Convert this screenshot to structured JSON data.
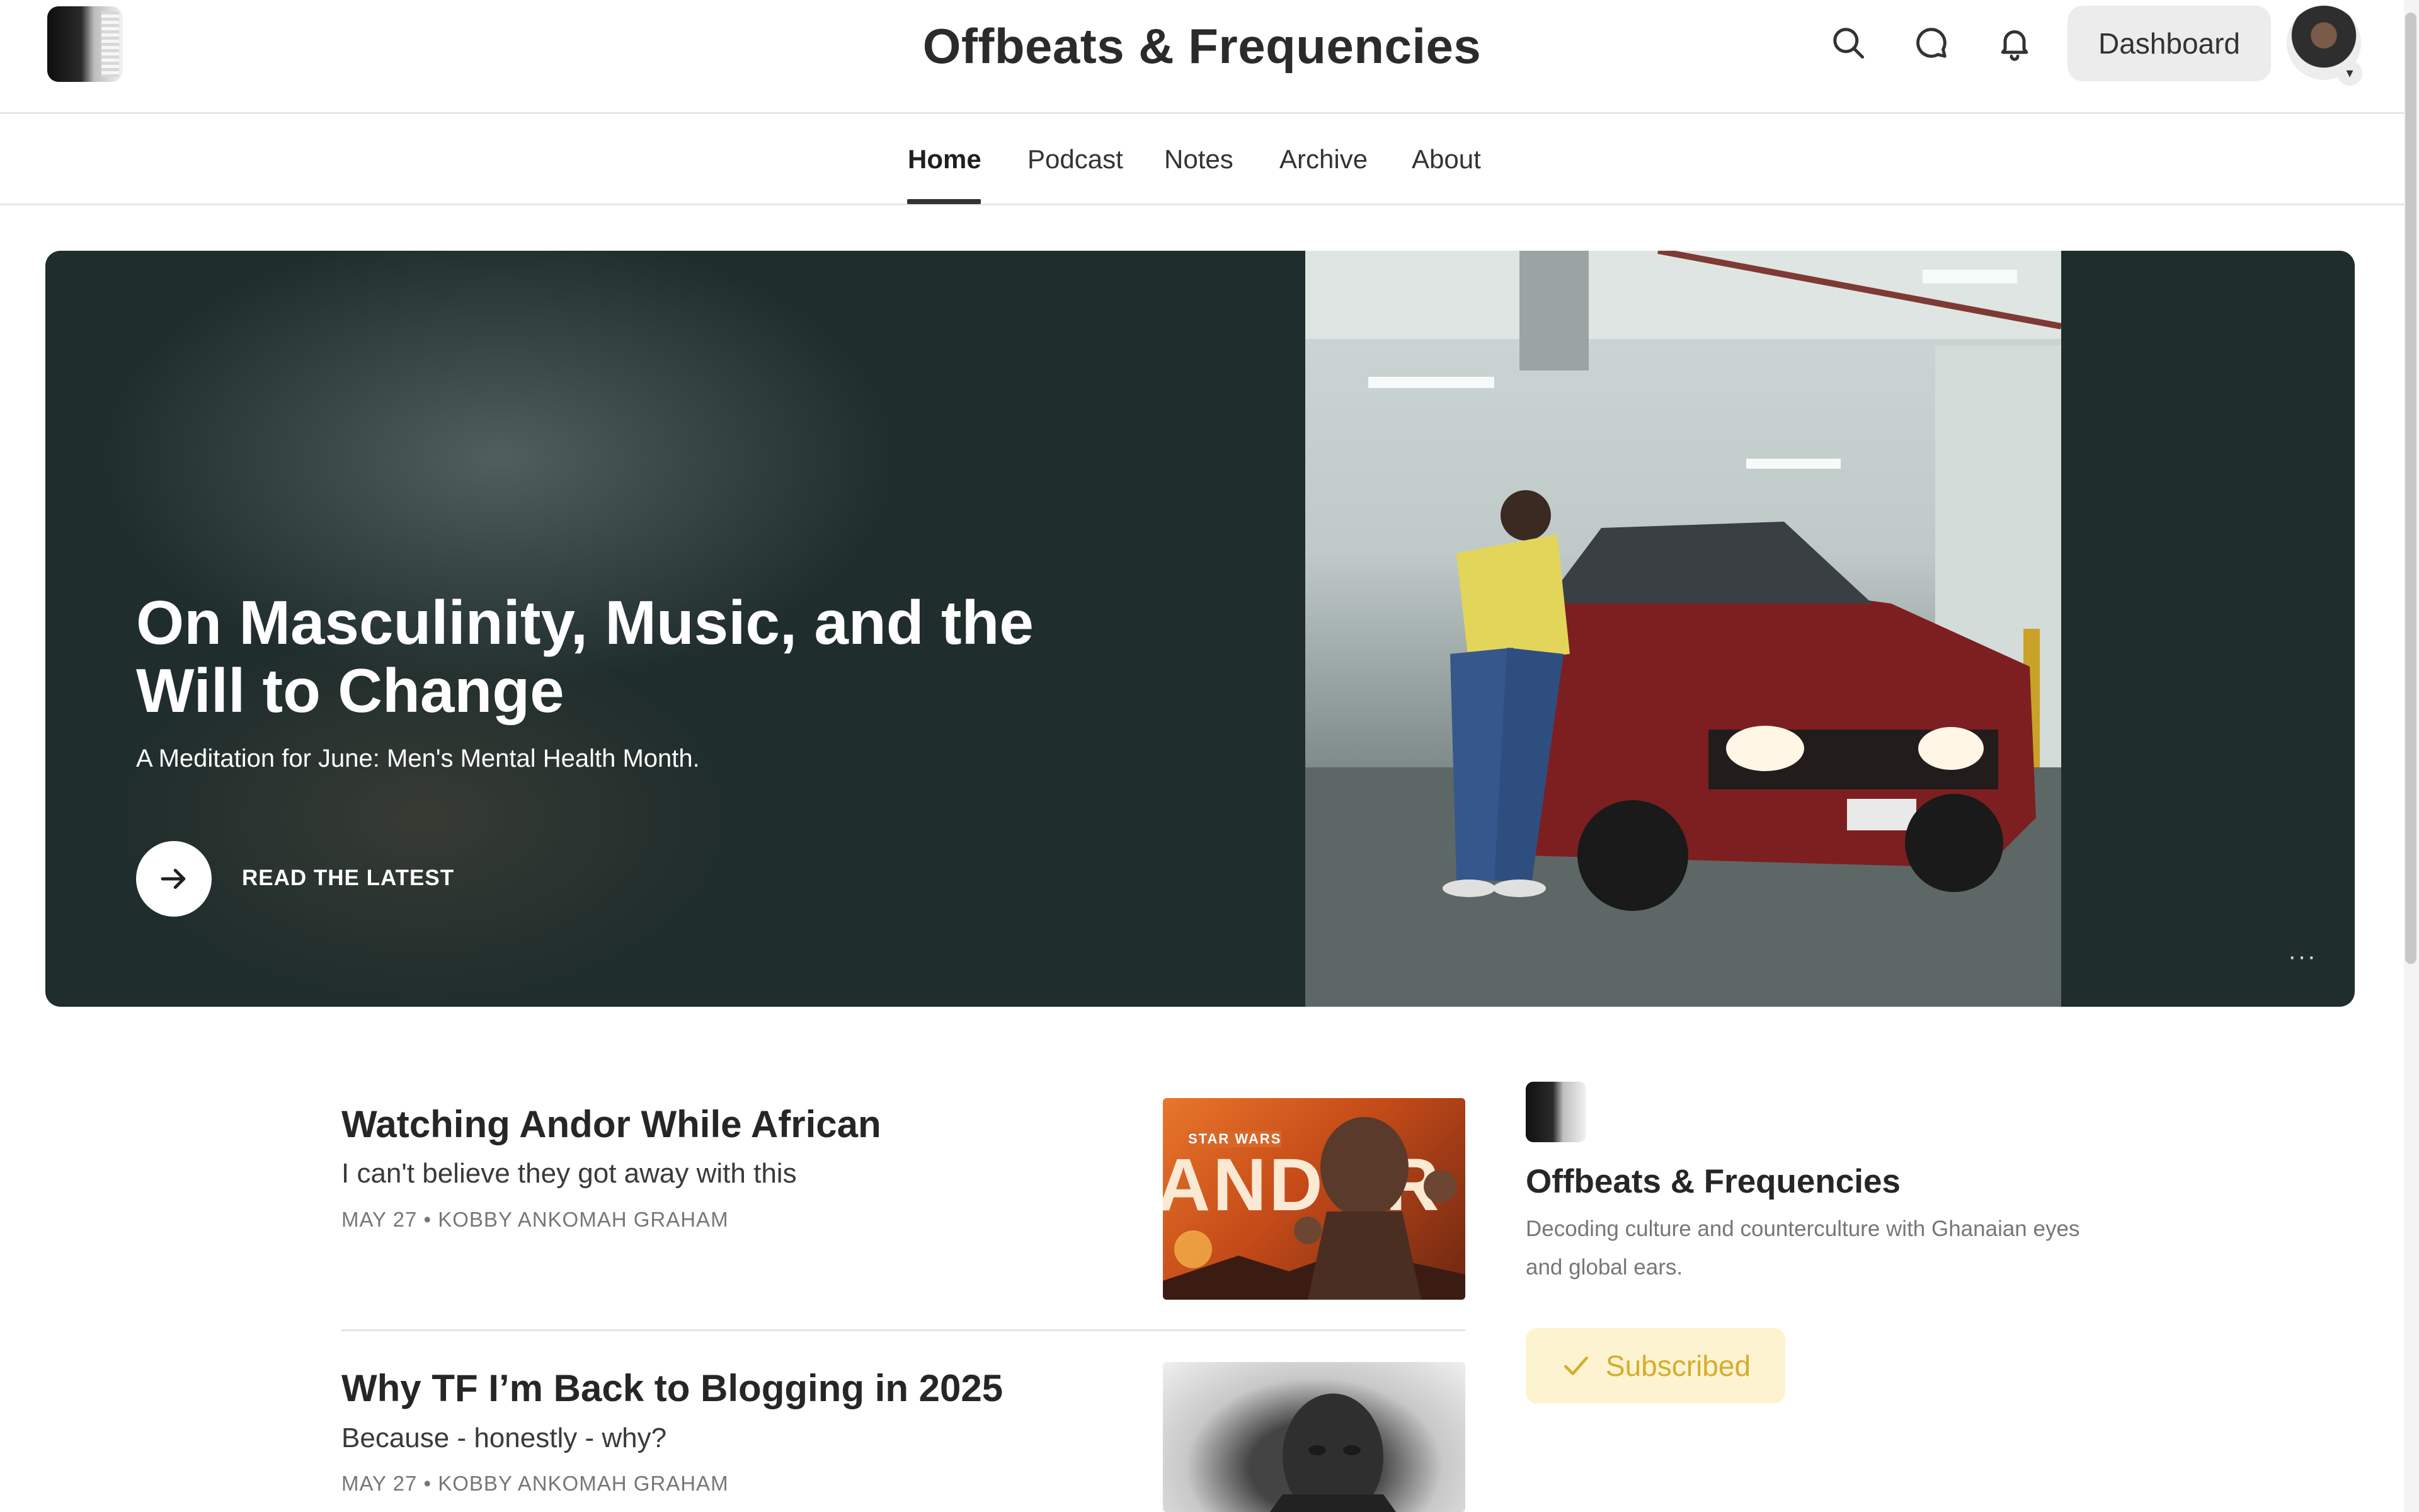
{
  "site": {
    "title": "Offbeats & Frequencies"
  },
  "header": {
    "dashboard_label": "Dashboard"
  },
  "nav": {
    "tabs": [
      {
        "label": "Home"
      },
      {
        "label": "Podcast"
      },
      {
        "label": "Notes"
      },
      {
        "label": "Archive"
      },
      {
        "label": "About"
      }
    ],
    "active": "Home"
  },
  "hero": {
    "title": "On Masculinity, Music, and the Will to Change",
    "subtitle": "A Meditation for June: Men's Mental Health Month.",
    "cta_label": "READ THE LATEST",
    "more_label": "···"
  },
  "posts": [
    {
      "title": "Watching Andor While African",
      "subtitle": "I can't believe they got away with this",
      "meta": "MAY 27 • KOBBY ANKOMAH GRAHAM",
      "thumb_text": "ANDOR",
      "thumb_kicker": "STAR WARS"
    },
    {
      "title": "Why TF I’m Back to Blogging in 2025",
      "subtitle": "Because - honestly - why?",
      "meta": "MAY 27 • KOBBY ANKOMAH GRAHAM"
    }
  ],
  "sidebar": {
    "name": "Offbeats & Frequencies",
    "description": "Decoding culture and counterculture with Ghanaian eyes and global ears.",
    "subscribed_label": "Subscribed"
  },
  "colors": {
    "hero_bg": "#1f2d2c",
    "subscribed_bg": "#fdf3d1",
    "subscribed_text": "#d6ad2c"
  },
  "icons": [
    "search-icon",
    "chat-icon",
    "bell-icon",
    "arrow-right-icon",
    "checkmark-icon",
    "chevron-down-icon"
  ]
}
